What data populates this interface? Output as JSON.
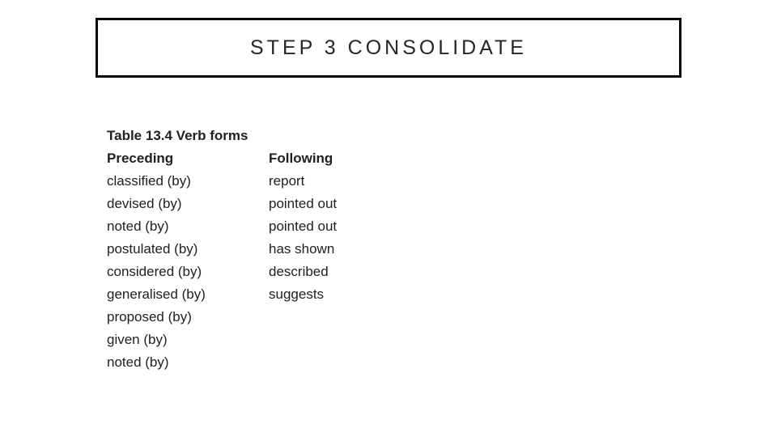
{
  "title": "STEP 3 CONSOLIDATE",
  "table": {
    "caption": "Table 13.4  Verb forms",
    "headers": [
      "Preceding",
      "Following"
    ],
    "rows": [
      [
        "classified (by)",
        "report"
      ],
      [
        "devised (by)",
        "pointed out"
      ],
      [
        "noted (by)",
        "pointed out"
      ],
      [
        "postulated (by)",
        "has shown"
      ],
      [
        "considered (by)",
        "described"
      ],
      [
        "generalised (by)",
        "suggests"
      ],
      [
        "proposed (by)",
        ""
      ],
      [
        "given (by)",
        ""
      ],
      [
        "noted (by)",
        ""
      ]
    ]
  }
}
